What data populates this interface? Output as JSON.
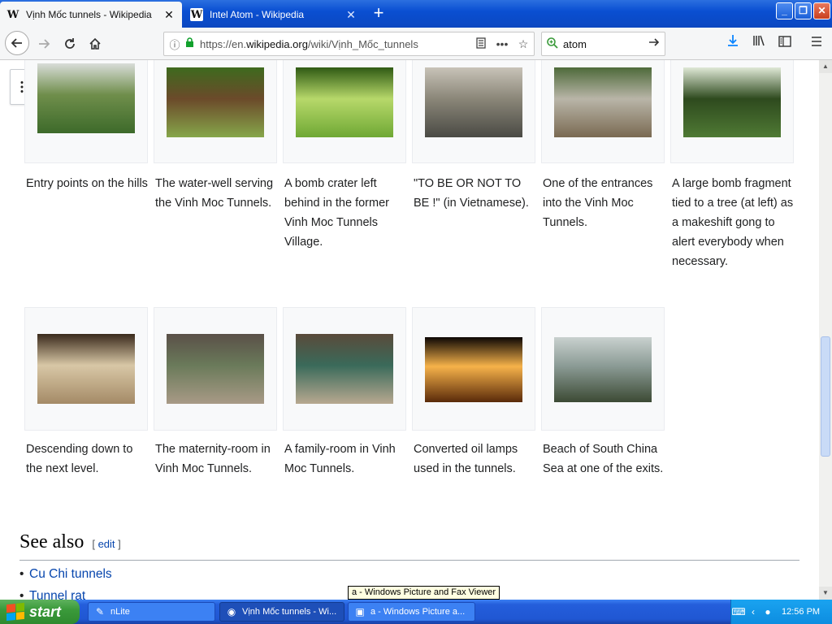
{
  "browser": {
    "tabs": [
      {
        "title": "Vịnh Mốc tunnels - Wikipedia",
        "favicon": "W",
        "close": "✕"
      },
      {
        "title": "Intel Atom - Wikipedia",
        "favicon": "W",
        "close": "✕"
      }
    ],
    "new_tab": "+",
    "window_buttons": {
      "min": "_",
      "max": "❐",
      "close": "✕"
    },
    "url": {
      "prefix": "https://en.",
      "domain": "wikipedia.org",
      "path": "/wiki/Vịnh_Mốc_tunnels"
    },
    "search_value": "atom"
  },
  "gallery": {
    "row1": [
      {
        "caption": "Entry points on the hills",
        "colors": [
          "#d8dcd8",
          "#3d6a2a",
          "#6f8e4b"
        ]
      },
      {
        "caption": "The water-well serving the Vinh Moc Tunnels.",
        "colors": [
          "#3e6a1e",
          "#86a64a",
          "#6b4a2a"
        ]
      },
      {
        "caption": "A bomb crater left behind in the former Vinh Moc Tunnels Village.",
        "colors": [
          "#2f5a14",
          "#6fa834",
          "#b7d86a"
        ]
      },
      {
        "caption": "\"TO BE OR NOT TO BE !\" (in Vietnamese).",
        "colors": [
          "#c8c3b8",
          "#4a4a44",
          "#8a8678"
        ]
      },
      {
        "caption": "One of the entrances into the Vinh Moc Tunnels.",
        "colors": [
          "#4e6a3a",
          "#7a6a52",
          "#b9b5a8"
        ]
      },
      {
        "caption": "A large bomb fragment tied to a tree (at left) as a makeshift gong to alert everybody when necessary.",
        "colors": [
          "#dfe8d6",
          "#4f7a34",
          "#2e4a1e"
        ]
      }
    ],
    "row2": [
      {
        "caption": "Descending down to the next level.",
        "colors": [
          "#3a2a1c",
          "#a48a66",
          "#d8c7a6"
        ]
      },
      {
        "caption": "The maternity-room in Vinh Moc Tunnels.",
        "colors": [
          "#5a5048",
          "#a89a86",
          "#6a7a5a"
        ]
      },
      {
        "caption": "A family-room in Vinh Moc Tunnels.",
        "colors": [
          "#5a4a3a",
          "#b8a890",
          "#3a6a5a"
        ]
      },
      {
        "caption": "Converted oil lamps used in the tunnels.",
        "colors": [
          "#0c0604",
          "#5a2a0a",
          "#f6b24a"
        ]
      },
      {
        "caption": "Beach of South China Sea at one of the exits.",
        "colors": [
          "#c9d1cf",
          "#3c4a34",
          "#8a9a94"
        ]
      }
    ]
  },
  "see_also": {
    "heading": "See also",
    "edit_open": "[",
    "edit_label": "edit",
    "edit_close": "]",
    "links": [
      "Cu Chi tunnels",
      "Tunnel rat"
    ]
  },
  "tooltip": "a - Windows Picture and Fax Viewer",
  "taskbar": {
    "start_label": "start",
    "items": [
      {
        "label": "nLite"
      },
      {
        "label": "Vịnh Mốc tunnels - Wi..."
      },
      {
        "label": "a - Windows Picture a..."
      }
    ],
    "clock": "12:56 PM"
  }
}
